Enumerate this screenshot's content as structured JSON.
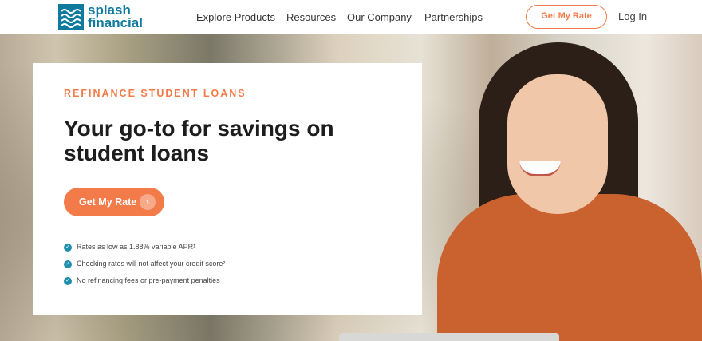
{
  "header": {
    "logo": {
      "line1": "splash",
      "line2": "financial"
    },
    "nav": [
      "Explore Products",
      "Resources",
      "Our Company",
      "Partnerships"
    ],
    "cta_label": "Get My Rate",
    "login_label": "Log In"
  },
  "hero": {
    "eyebrow": "REFINANCE STUDENT LOANS",
    "headline": "Your go-to for savings on student loans",
    "cta_label": "Get My Rate",
    "cta_arrow": "›",
    "bullets": [
      "Rates as low as 1.88% variable APR¹",
      "Checking rates will not affect your credit score²",
      "No refinancing fees or pre-payment penalties"
    ]
  },
  "colors": {
    "accent": "#f37b4a",
    "brand": "#0f7a9e",
    "check": "#1f8fab"
  }
}
